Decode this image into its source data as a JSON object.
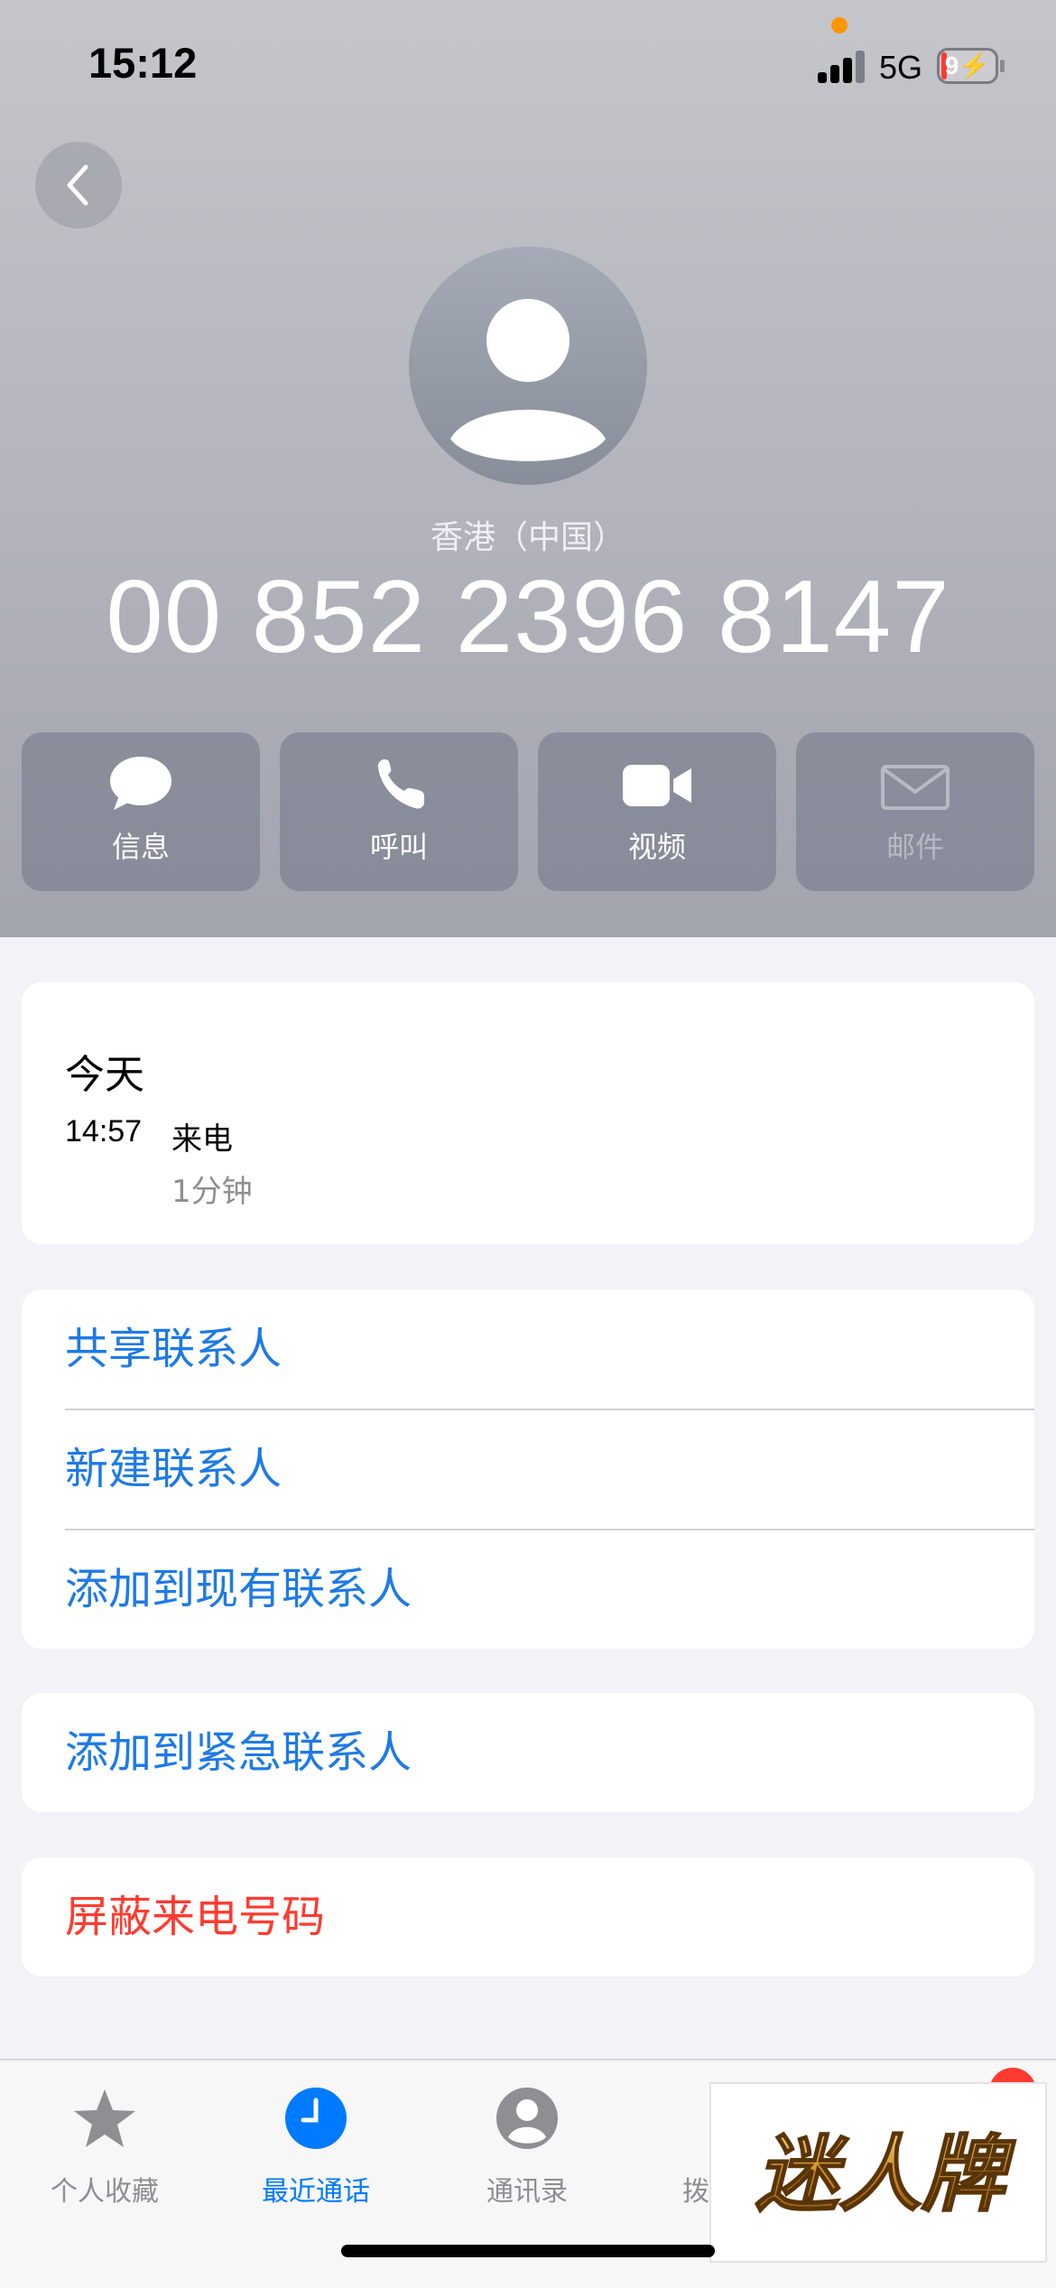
{
  "status_bar": {
    "time": "15:12",
    "network": "5G",
    "battery": "9",
    "battery_level": 0.09,
    "icons": [
      "camera-indicator-icon",
      "signal-icon",
      "battery-charging-icon"
    ]
  },
  "header": {
    "back_icon": "chevron-left-icon",
    "avatar_icon": "person-silhouette-icon",
    "location": "香港（中国）",
    "phone_number": "00 852 2396 8147"
  },
  "actions": [
    {
      "label": "信息",
      "icon": "message-bubble-icon",
      "enabled": true
    },
    {
      "label": "呼叫",
      "icon": "phone-icon",
      "enabled": true
    },
    {
      "label": "视频",
      "icon": "video-camera-icon",
      "enabled": true
    },
    {
      "label": "邮件",
      "icon": "envelope-icon",
      "enabled": false
    }
  ],
  "call_history": {
    "heading": "今天",
    "entries": [
      {
        "time": "14:57",
        "type": "来电",
        "duration": "1分钟"
      }
    ]
  },
  "contact_options": {
    "items": [
      "共享联系人",
      "新建联系人",
      "添加到现有联系人"
    ]
  },
  "emergency": {
    "label": "添加到紧急联系人"
  },
  "block": {
    "label": "屏蔽来电号码"
  },
  "tab_bar": {
    "tabs": [
      {
        "label": "个人收藏",
        "icon": "star-icon",
        "active": false
      },
      {
        "label": "最近通话",
        "icon": "clock-icon",
        "active": true
      },
      {
        "label": "通讯录",
        "icon": "contact-icon",
        "active": false
      },
      {
        "label": "拨",
        "icon": "keypad-icon",
        "active": false
      }
    ],
    "accent_color": "#007aff"
  },
  "watermark": {
    "text": "迷人牌"
  },
  "colors": {
    "link": "#1e7ae6",
    "danger": "#ff3b30",
    "tab_active": "#007aff",
    "tab_inactive": "#8e8e93"
  }
}
